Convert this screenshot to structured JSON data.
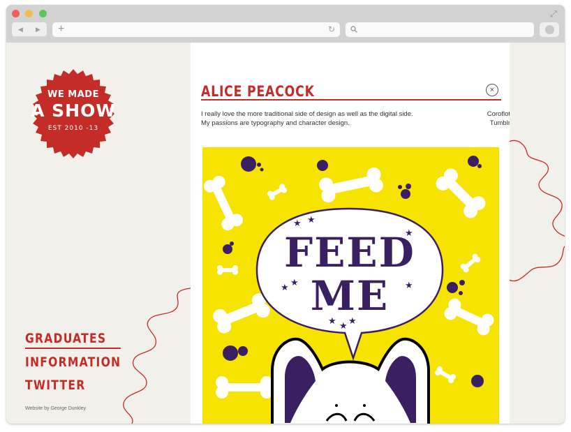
{
  "browser": {
    "url_value": "",
    "search_value": ""
  },
  "brand": {
    "line1": "WE MADE",
    "line2": "A SHOW",
    "line3": "EST 2010 -13"
  },
  "nav": {
    "items": [
      "GRADUATES",
      "INFORMATION",
      "TWITTER"
    ],
    "active": "GRADUATES"
  },
  "credit": "Website by George Dunkley",
  "profile": {
    "name": "ALICE PEACOCK",
    "close_icon": "×",
    "bio_line1": "I really love the more traditional side of design as well as the digital side.",
    "bio_line2": "My passions are typography and character design.",
    "links": [
      "Coroflot",
      "Tumblr"
    ]
  },
  "artwork": {
    "line1": "FEED",
    "line2": "ME"
  },
  "colors": {
    "accent": "#c42c28",
    "page_bg": "#f2f0ea",
    "art_yellow": "#f6e400",
    "art_purple": "#3a1f63"
  }
}
